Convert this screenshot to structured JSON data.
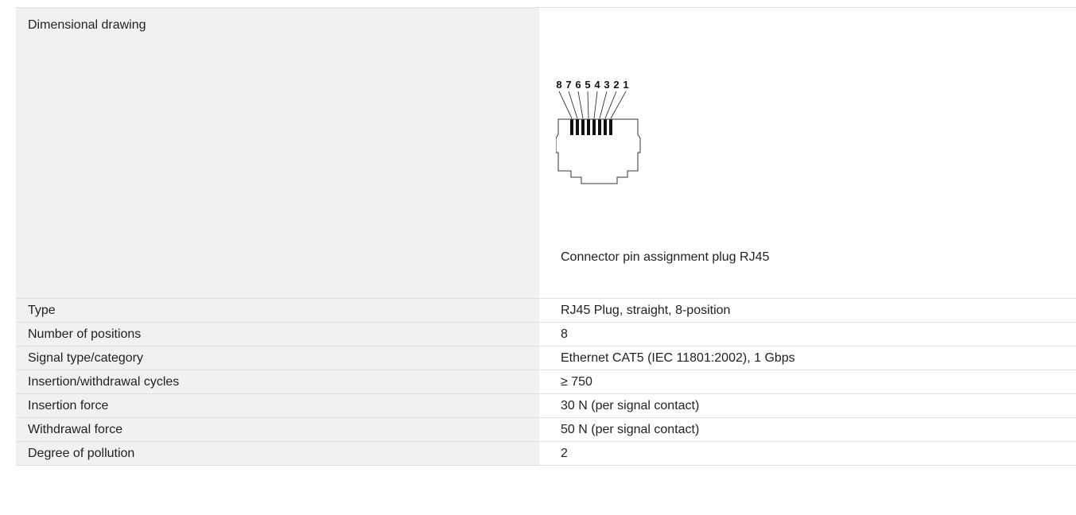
{
  "drawing_section": {
    "label": "Dimensional drawing",
    "pin_numbers": [
      "8",
      "7",
      "6",
      "5",
      "4",
      "3",
      "2",
      "1"
    ],
    "caption": "Connector pin assignment plug RJ45"
  },
  "specs": [
    {
      "label": "Type",
      "value": "RJ45 Plug, straight, 8-position"
    },
    {
      "label": "Number of positions",
      "value": "8"
    },
    {
      "label": "Signal type/category",
      "value": "Ethernet CAT5 (IEC 11801:2002), 1 Gbps"
    },
    {
      "label": "Insertion/withdrawal cycles",
      "value": "≥ 750"
    },
    {
      "label": "Insertion force",
      "value": "30 N (per signal contact)"
    },
    {
      "label": "Withdrawal force",
      "value": "50 N (per signal contact)"
    },
    {
      "label": "Degree of pollution",
      "value": "2"
    }
  ]
}
